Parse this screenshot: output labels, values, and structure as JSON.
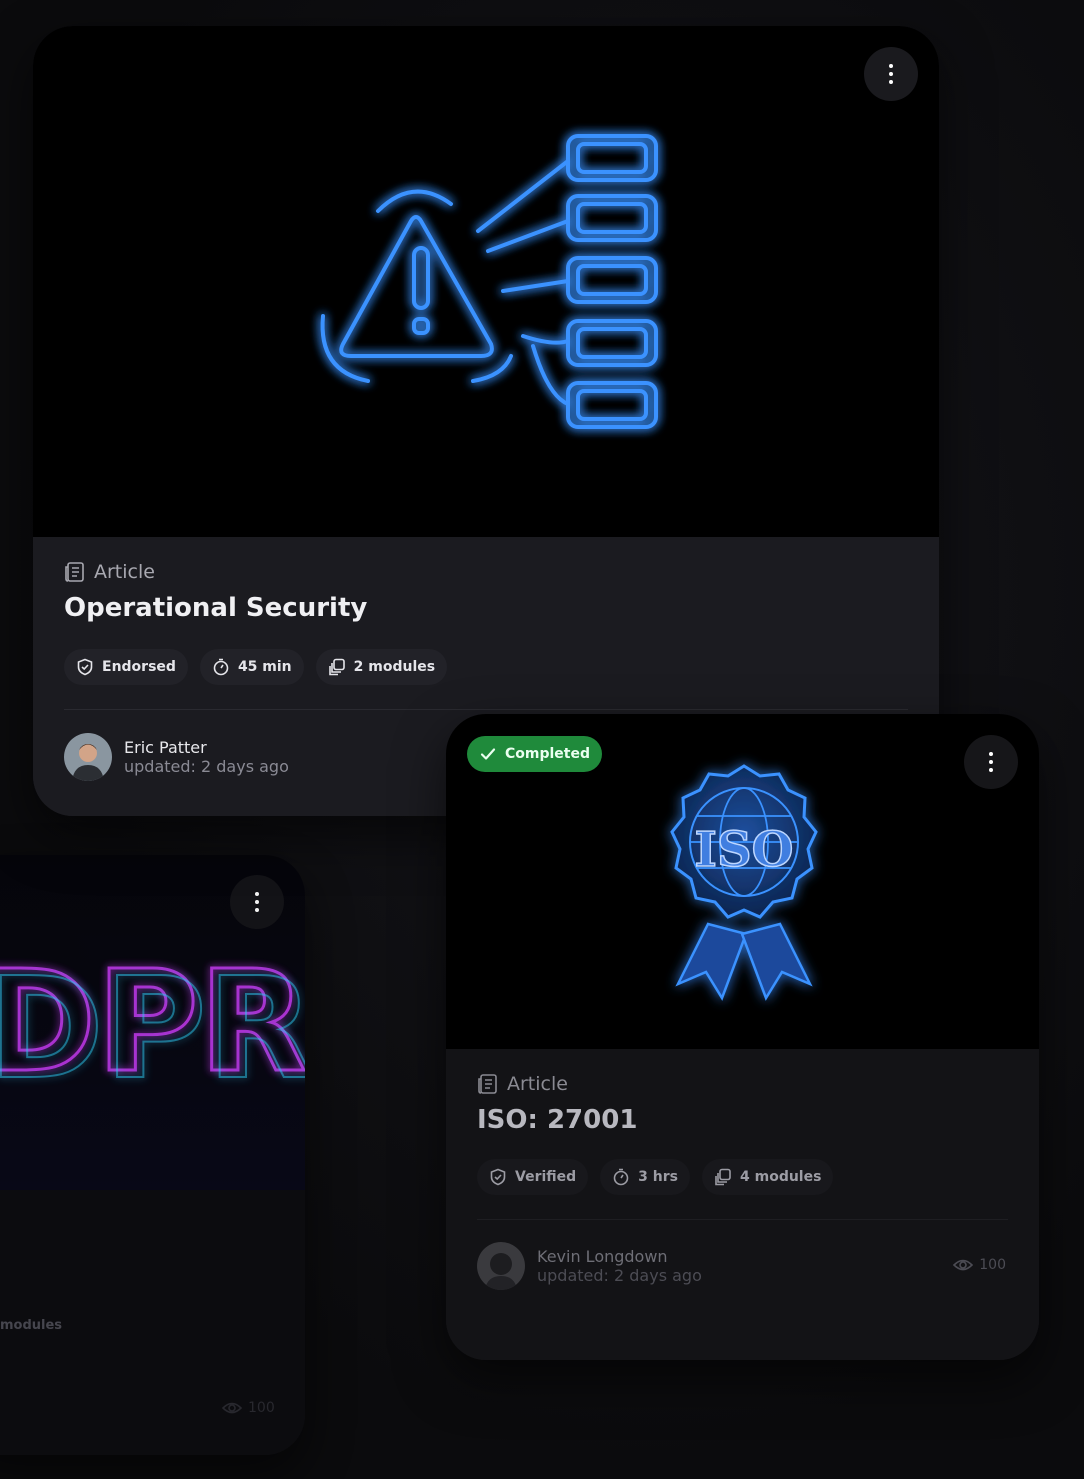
{
  "card_main": {
    "type_label": "Article",
    "title": "Operational Security",
    "chips": [
      {
        "label": "Endorsed",
        "icon": "shield-check-icon"
      },
      {
        "label": "45 min",
        "icon": "timer-icon"
      },
      {
        "label": "2 modules",
        "icon": "modules-icon"
      }
    ],
    "author_name": "Eric Patter",
    "updated": "updated: 2 days ago"
  },
  "card_iso": {
    "status_badge": "Completed",
    "type_label": "Article",
    "title": "ISO: 27001",
    "chips": [
      {
        "label": "Verified",
        "icon": "shield-check-icon"
      },
      {
        "label": "3 hrs",
        "icon": "timer-icon"
      },
      {
        "label": "4 modules",
        "icon": "modules-icon"
      }
    ],
    "author_name": "Kevin Longdown",
    "updated": "updated: 2 days ago",
    "views": "100"
  },
  "card_gdpr": {
    "hero_text": "DPR",
    "chip_modules": "modules",
    "views": "100"
  },
  "colors": {
    "accent_neon_blue": "#2f8bff",
    "completed_green": "#1f8a3b",
    "neon_pink": "#d23cff",
    "neon_cyan": "#2fd6ff"
  }
}
